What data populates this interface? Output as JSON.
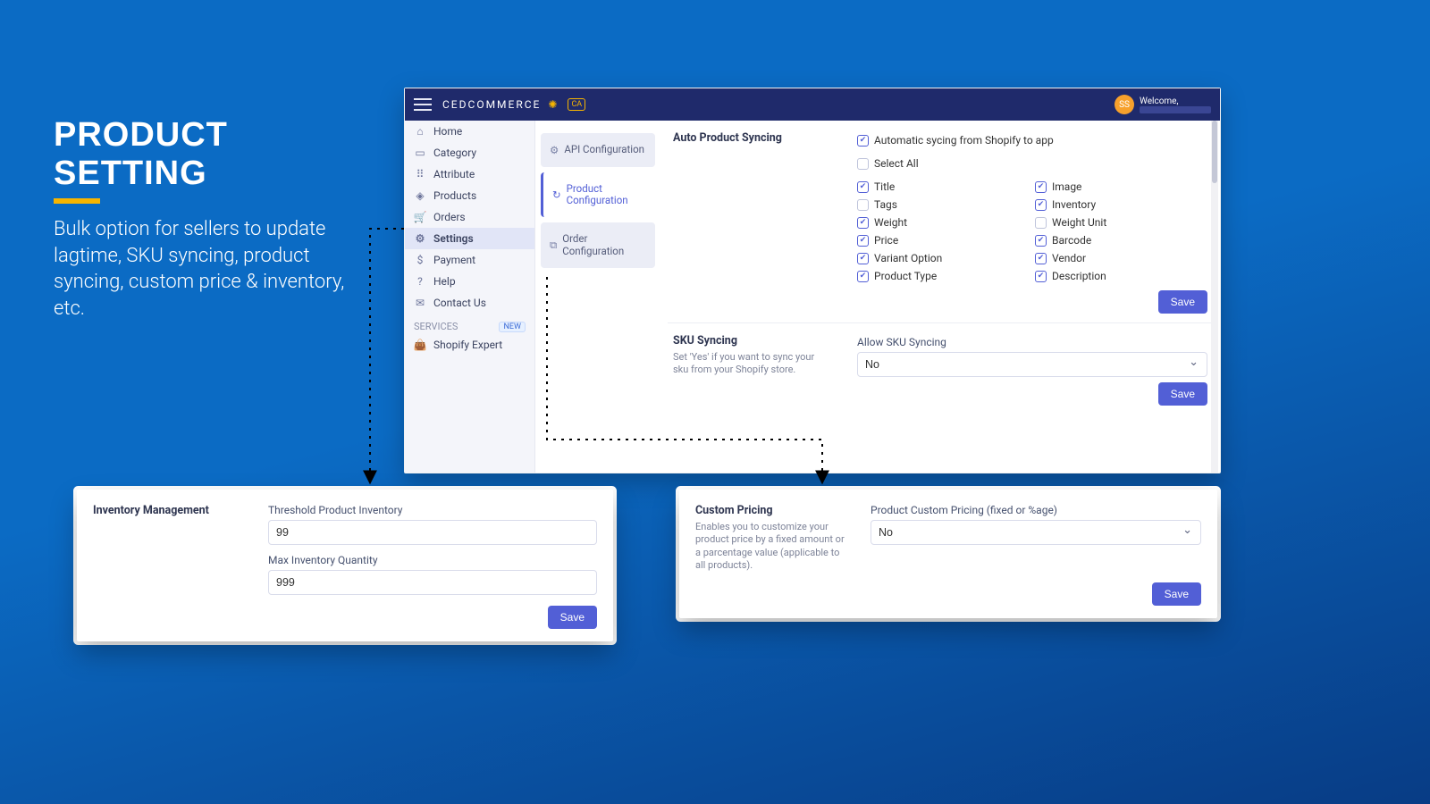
{
  "promo": {
    "title": "PRODUCT SETTING",
    "body": "Bulk option for sellers to update lagtime, SKU syncing, product syncing, custom price & inventory, etc."
  },
  "header": {
    "brand_text": "CEDCOMMERCE",
    "brand_sub": "CA",
    "avatar_initials": "SS",
    "welcome": "Welcome,"
  },
  "sidebar": [
    {
      "icon": "⌂",
      "label": "Home"
    },
    {
      "icon": "▭",
      "label": "Category"
    },
    {
      "icon": "⠿",
      "label": "Attribute"
    },
    {
      "icon": "◈",
      "label": "Products"
    },
    {
      "icon": "🛒",
      "label": "Orders"
    },
    {
      "icon": "⚙",
      "label": "Settings",
      "active": true
    },
    {
      "icon": "$",
      "label": "Payment"
    },
    {
      "icon": "?",
      "label": "Help"
    },
    {
      "icon": "✉",
      "label": "Contact Us"
    }
  ],
  "sidebar_services": {
    "heading": "SERVICES",
    "badge": "NEW",
    "items": [
      {
        "icon": "👜",
        "label": "Shopify Expert"
      }
    ]
  },
  "subnav": [
    {
      "icon": "⚙",
      "label": "API Configuration"
    },
    {
      "icon": "↻",
      "label": "Product Configuration",
      "active": true
    },
    {
      "icon": "⧉",
      "label": "Order Configuration"
    }
  ],
  "auto_sync": {
    "heading": "Auto Product Syncing",
    "master": {
      "label": "Automatic sycing from Shopify to app",
      "checked": true
    },
    "select_all": {
      "label": "Select All",
      "checked": false
    },
    "items": [
      {
        "label": "Title",
        "checked": true
      },
      {
        "label": "Image",
        "checked": true
      },
      {
        "label": "Tags",
        "checked": false
      },
      {
        "label": "Inventory",
        "checked": true
      },
      {
        "label": "Weight",
        "checked": true
      },
      {
        "label": "Weight Unit",
        "checked": false
      },
      {
        "label": "Price",
        "checked": true
      },
      {
        "label": "Barcode",
        "checked": true
      },
      {
        "label": "Variant Option",
        "checked": true
      },
      {
        "label": "Vendor",
        "checked": true
      },
      {
        "label": "Product Type",
        "checked": true
      },
      {
        "label": "Description",
        "checked": true
      }
    ],
    "save": "Save"
  },
  "sku_sync": {
    "heading": "SKU Syncing",
    "sub": "Set 'Yes' if you want to sync your sku from your Shopify store.",
    "field_label": "Allow SKU Syncing",
    "value": "No",
    "save": "Save"
  },
  "inv_popout": {
    "heading": "Inventory Management",
    "field1_label": "Threshold Product Inventory",
    "field1_value": "99",
    "field2_label": "Max Inventory Quantity",
    "field2_value": "999",
    "save": "Save"
  },
  "cp_popout": {
    "heading": "Custom Pricing",
    "sub": "Enables you to customize your product price by a fixed amount or a parcentage value (applicable to all products).",
    "field_label": "Product Custom Pricing (fixed or %age)",
    "value": "No",
    "save": "Save"
  }
}
